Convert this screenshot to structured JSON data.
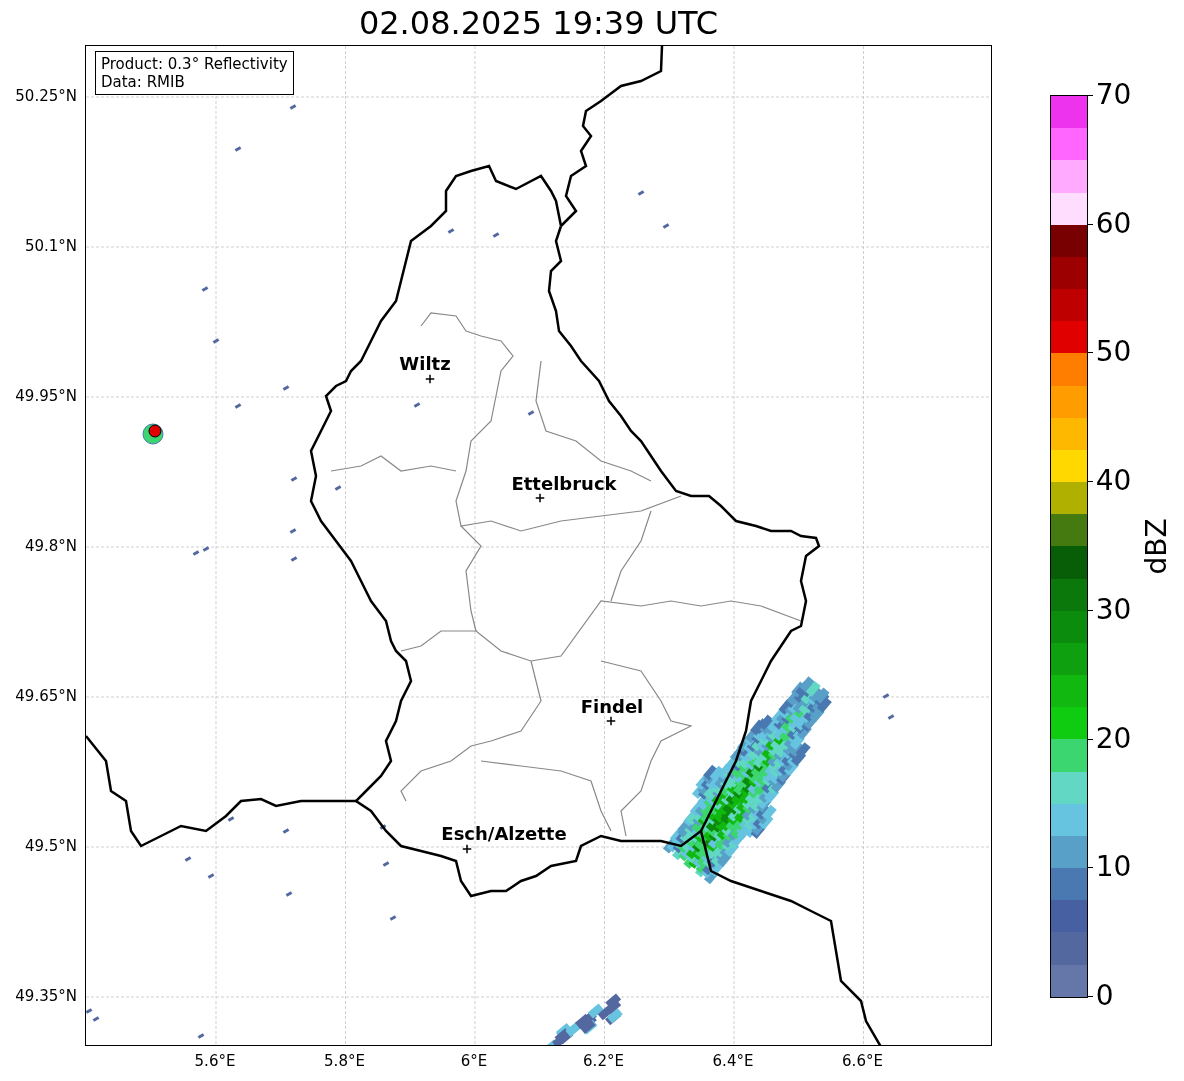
{
  "title": "02.08.2025 19:39 UTC",
  "info_box": {
    "lines": [
      "Product: 0.3° Reflectivity",
      "Data: RMIB"
    ]
  },
  "map": {
    "lat_labels": [
      "50.25°N",
      "50.1°N",
      "49.95°N",
      "49.8°N",
      "49.65°N",
      "49.5°N",
      "49.35°N"
    ],
    "lon_labels": [
      "5.6°E",
      "5.8°E",
      "6°E",
      "6.2°E",
      "6.4°E",
      "6.6°E"
    ],
    "cities": [
      {
        "name": "Wiltz"
      },
      {
        "name": "Ettelbruck"
      },
      {
        "name": "Findel"
      },
      {
        "name": "Esch/Alzette"
      }
    ]
  },
  "colorbar": {
    "label": "dBZ",
    "ticks": [
      "70",
      "60",
      "50",
      "40",
      "30",
      "20",
      "10",
      "0"
    ],
    "bands": [
      {
        "color": "#ee33ee"
      },
      {
        "color": "#ff66ff"
      },
      {
        "color": "#ffaaff"
      },
      {
        "color": "#ffddff"
      },
      {
        "color": "#780000"
      },
      {
        "color": "#9c0000"
      },
      {
        "color": "#be0000"
      },
      {
        "color": "#e00000"
      },
      {
        "color": "#ff7e00"
      },
      {
        "color": "#ff9c00"
      },
      {
        "color": "#ffb800"
      },
      {
        "color": "#ffd800"
      },
      {
        "color": "#b0b000"
      },
      {
        "color": "#447a10"
      },
      {
        "color": "#075e07"
      },
      {
        "color": "#0a780a"
      },
      {
        "color": "#0c8c0c"
      },
      {
        "color": "#0fa00f"
      },
      {
        "color": "#10b810"
      },
      {
        "color": "#10cc10"
      },
      {
        "color": "#3cd670"
      },
      {
        "color": "#62d8c4"
      },
      {
        "color": "#66c4e0"
      },
      {
        "color": "#58a0c8"
      },
      {
        "color": "#4a78b0"
      },
      {
        "color": "#4660a2"
      },
      {
        "color": "#5468a0"
      },
      {
        "color": "#6577a8"
      }
    ]
  }
}
